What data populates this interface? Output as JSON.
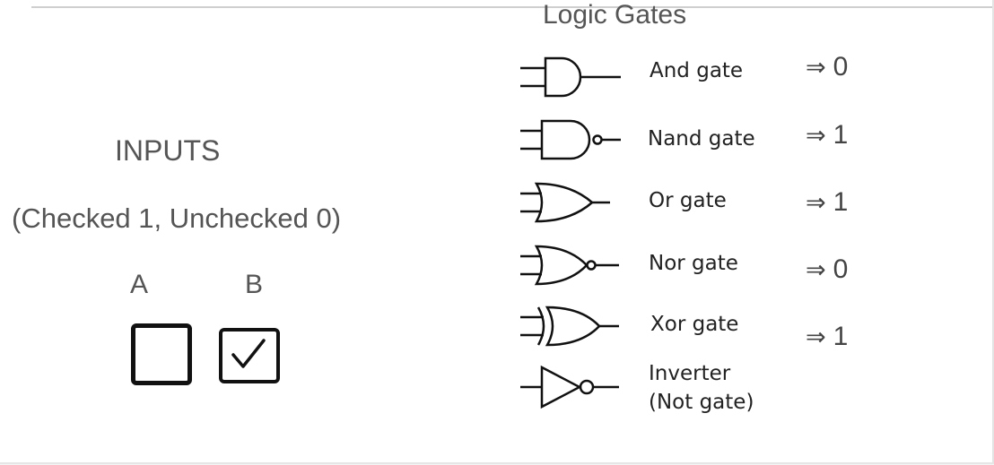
{
  "title": "Logic Gates",
  "inputs": {
    "heading": "INPUTS",
    "note": "(Checked 1, Unchecked 0)",
    "a": {
      "label": "A",
      "checked": false
    },
    "b": {
      "label": "B",
      "checked": true
    }
  },
  "arrow_symbol": "⇒",
  "gates": [
    {
      "name": "And gate",
      "output": "0",
      "icon": "and-gate-icon"
    },
    {
      "name": "Nand gate",
      "output": "1",
      "icon": "nand-gate-icon"
    },
    {
      "name": "Or gate",
      "output": "1",
      "icon": "or-gate-icon"
    },
    {
      "name": "Nor gate",
      "output": "0",
      "icon": "nor-gate-icon"
    },
    {
      "name": "Xor gate",
      "output": "1",
      "icon": "xor-gate-icon"
    },
    {
      "name_line1": "Inverter",
      "name_line2": "(Not gate)",
      "icon": "not-gate-icon"
    }
  ]
}
